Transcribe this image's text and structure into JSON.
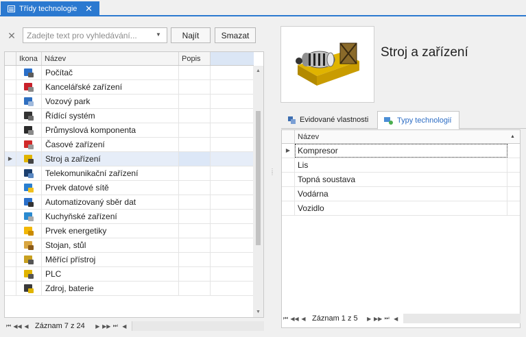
{
  "window": {
    "tab_title": "Třídy technologie",
    "tab_close": "✕"
  },
  "search": {
    "clear_icon": "✕",
    "placeholder": "Zadejte text pro vyhledávání...",
    "find_label": "Najít",
    "clear_label": "Smazat"
  },
  "grid": {
    "columns": [
      "Ikona",
      "Název",
      "Popis"
    ],
    "rows": [
      {
        "icon": "computer-icon",
        "name": "Počítač"
      },
      {
        "icon": "stapler-icon",
        "name": "Kancelářské zařízení"
      },
      {
        "icon": "truck-icon",
        "name": "Vozový park"
      },
      {
        "icon": "control-system-icon",
        "name": "Řídící systém"
      },
      {
        "icon": "industrial-component-icon",
        "name": "Průmyslová komponenta"
      },
      {
        "icon": "time-device-icon",
        "name": "Časové zařízení"
      },
      {
        "icon": "machine-icon",
        "name": "Stroj a zařízení"
      },
      {
        "icon": "telephone-icon",
        "name": "Telekomunikační zařízení"
      },
      {
        "icon": "network-icon",
        "name": "Prvek datové sítě"
      },
      {
        "icon": "data-collection-icon",
        "name": "Automatizovaný sběr dat"
      },
      {
        "icon": "kitchen-icon",
        "name": "Kuchyňské zařízení"
      },
      {
        "icon": "lightning-icon",
        "name": "Prvek energetiky"
      },
      {
        "icon": "desk-icon",
        "name": "Stojan, stůl"
      },
      {
        "icon": "measuring-icon",
        "name": "Měřící přístroj"
      },
      {
        "icon": "plc-icon",
        "name": "PLC"
      },
      {
        "icon": "battery-icon",
        "name": "Zdroj, baterie"
      }
    ],
    "selected_index": 6,
    "pager_text": "Záznam 7 z 24"
  },
  "detail": {
    "title": "Stroj a zařízení",
    "image_icon": "machine-generator-icon",
    "tabs": [
      {
        "label": "Evidované vlastnosti",
        "icon": "properties-icon"
      },
      {
        "label": "Typy technologií",
        "icon": "types-icon"
      }
    ],
    "active_tab": 1,
    "column": "Název",
    "rows": [
      "Kompresor",
      "Lis",
      "Topná soustava",
      "Vodárna",
      "Vozidlo"
    ],
    "pager_text": "Záznam 1 z 5"
  },
  "colors": {
    "accent": "#2b79d0",
    "selected_row": "#e6edf8"
  }
}
